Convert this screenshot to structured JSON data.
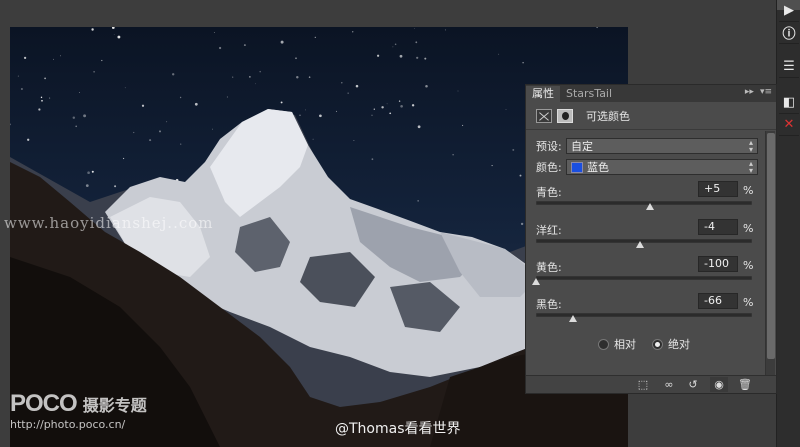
{
  "panel": {
    "tabs": [
      {
        "label": "属性"
      },
      {
        "label": "StarsTail"
      }
    ],
    "tab_menu_glyph": "▸▸",
    "title": "可选颜色",
    "preset_label": "预设:",
    "preset_value": "自定",
    "color_label": "颜色:",
    "color_value": "蓝色",
    "color_swatch": "#1a4fe0",
    "sliders": [
      {
        "label": "青色:",
        "value": "+5",
        "unit": "%",
        "level": 0.53
      },
      {
        "label": "洋红:",
        "value": "-4",
        "unit": "%",
        "level": 0.48
      },
      {
        "label": "黄色:",
        "value": "-100",
        "unit": "%",
        "level": 0.0
      },
      {
        "label": "黑色:",
        "value": "-66",
        "unit": "%",
        "level": 0.17
      }
    ],
    "modes": [
      {
        "label": "相对",
        "selected": false
      },
      {
        "label": "绝对",
        "selected": true
      }
    ]
  },
  "footer_icons": [
    "clip-to-layer-icon",
    "visibility-chain-icon",
    "reset-icon",
    "eye-icon",
    "trash-icon"
  ],
  "dock_icons": [
    "play-icon",
    "info-icon",
    "layers-icon",
    "adjustments-icon",
    "cancel-icon"
  ],
  "watermarks": {
    "mid": "www.haoyidianshej..com",
    "poco": "POCO",
    "poco_sub": "摄影专题",
    "poco_url": "http://photo.poco.cn/",
    "credit": "@Thomas看看世界"
  }
}
